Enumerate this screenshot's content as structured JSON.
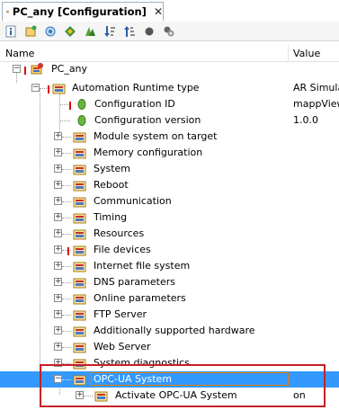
{
  "tab": {
    "title": "PC_any [Configuration]",
    "close_glyph": "✕"
  },
  "toolbar": {
    "icons": [
      "info-icon",
      "add-icon",
      "properties-icon",
      "arrange-icon",
      "group-icon",
      "sort-descending-icon",
      "sort-ascending-icon",
      "record-icon",
      "settings-icon"
    ]
  },
  "columns": {
    "name": "Name",
    "value": "Value"
  },
  "tree": {
    "root": "PC_any",
    "runtime": {
      "label": "Automation Runtime type",
      "value": "AR Simulat"
    },
    "config_id": {
      "label": "Configuration ID",
      "value": "mappView"
    },
    "config_version": {
      "label": "Configuration version",
      "value": "1.0.0"
    },
    "nodes": [
      "Module system on target",
      "Memory configuration",
      "System",
      "Reboot",
      "Communication",
      "Timing",
      "Resources",
      "File devices",
      "Internet file system",
      "DNS parameters",
      "Online parameters",
      "FTP Server",
      "Additionally supported hardware",
      "Web Server",
      "System diagnostics"
    ],
    "opcua": {
      "label": "OPC-UA System"
    },
    "activate": {
      "label": "Activate OPC-UA System",
      "value": "on"
    }
  },
  "colors": {
    "selection": "#3399ff",
    "highlight_box": "#c62026",
    "red_marker": "#e00000"
  }
}
